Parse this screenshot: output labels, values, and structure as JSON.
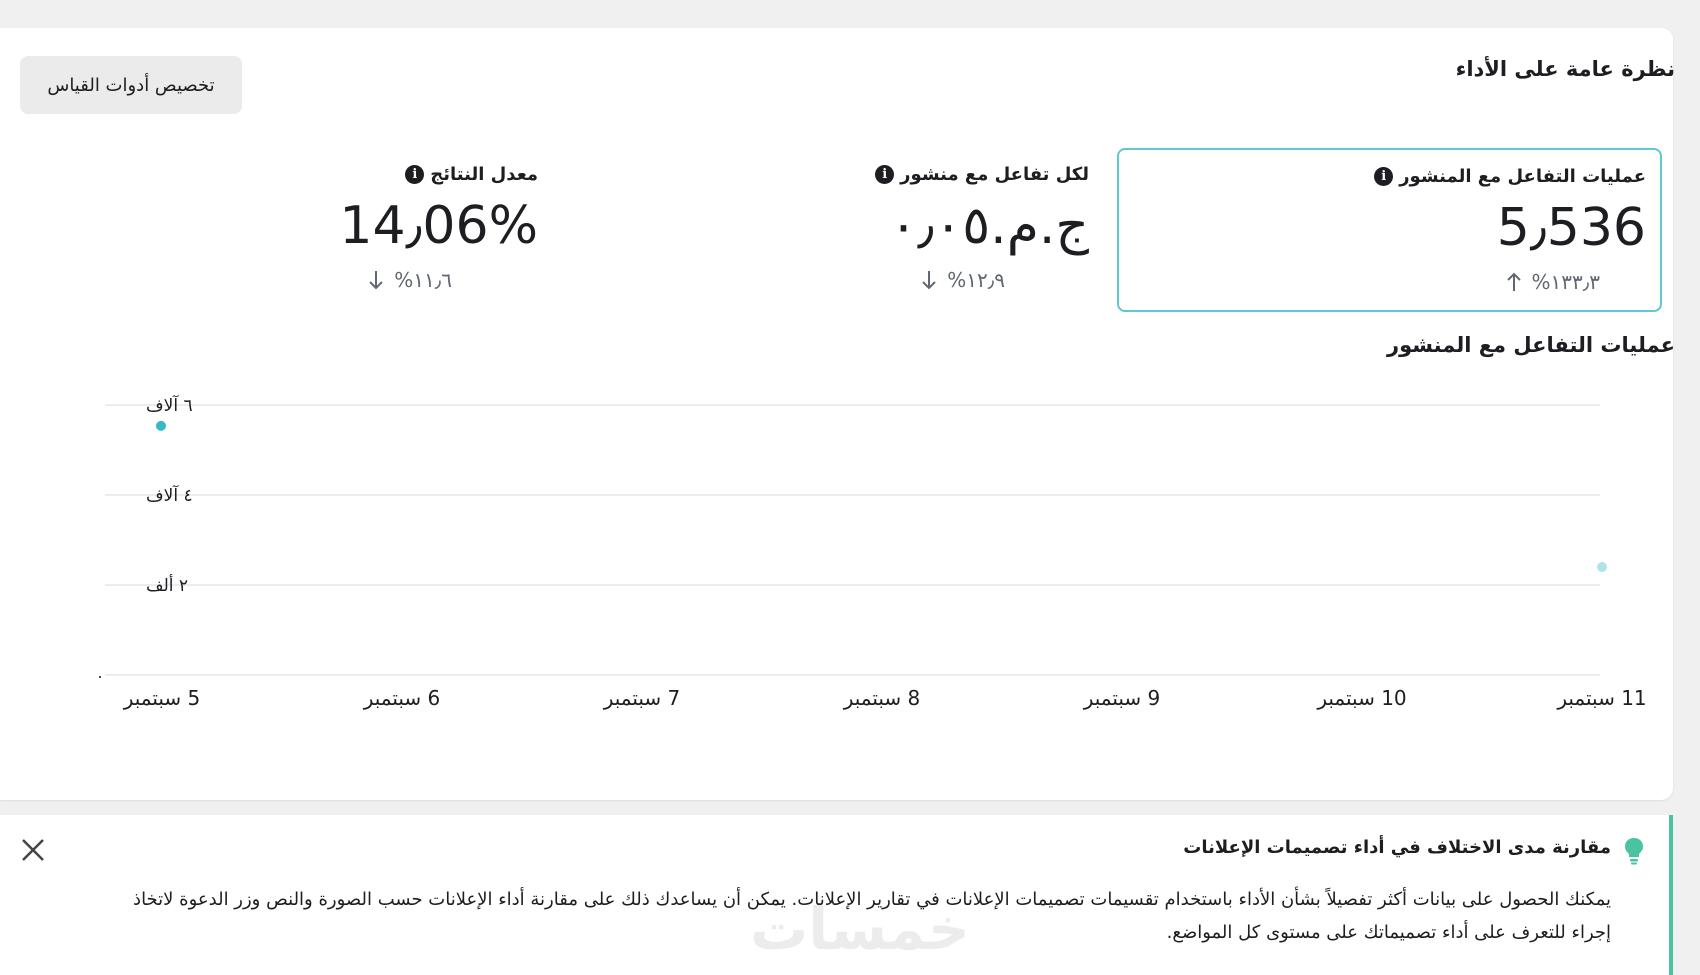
{
  "header": {
    "title": "نظرة عامة على الأداء",
    "customize_button": "تخصيص أدوات القياس"
  },
  "metrics": [
    {
      "label": "عمليات التفاعل مع المنشور",
      "value": "5٫536",
      "delta": "%١٣٣٫٣",
      "direction": "up",
      "selected": true
    },
    {
      "label": "لكل تفاعل مع منشور",
      "value": "ج.م.‏٠٫٠٥",
      "delta": "%١٢٫٩",
      "direction": "down",
      "selected": false
    },
    {
      "label": "معدل النتائج",
      "value": "14٫06%",
      "delta": "%١١٫٦",
      "direction": "down",
      "selected": false
    }
  ],
  "chart_title": "عمليات التفاعل مع المنشور",
  "chart_data": {
    "type": "scatter",
    "title": "عمليات التفاعل مع المنشور",
    "x": [
      "5 سبتمبر",
      "6 سبتمبر",
      "7 سبتمبر",
      "8 سبتمبر",
      "9 سبتمبر",
      "10 سبتمبر",
      "11 سبتمبر"
    ],
    "y_ticks": [
      "٢ ألف",
      "٤ آلاف",
      "٦ آلاف"
    ],
    "y_zero_label": ".",
    "ylim": [
      0,
      6000
    ],
    "series": [
      {
        "points": [
          {
            "x": "5 سبتمبر",
            "y": 5536
          },
          {
            "x": "11 سبتمبر",
            "y": 2400
          }
        ]
      }
    ],
    "grid": true,
    "colors": {
      "primary": "#34b9c7",
      "faded": "#aee3e8"
    }
  },
  "tip": {
    "title": "مقارنة مدى الاختلاف في أداء تصميمات الإعلانات",
    "body": "يمكنك الحصول على بيانات أكثر تفصيلاً بشأن الأداء باستخدام تقسيمات تصميمات الإعلانات في تقارير الإعلانات. يمكن أن يساعدك ذلك على مقارنة أداء الإعلانات حسب الصورة والنص وزر الدعوة لاتخاذ إجراء للتعرف على أداء تصميماتك على مستوى كل المواضع."
  },
  "watermark": "خمسات",
  "icons": {
    "info": "info-icon",
    "up": "arrow-up-icon",
    "down": "arrow-down-icon",
    "close": "close-icon",
    "bulb": "lightbulb-icon"
  },
  "colors": {
    "accent": "#5fc8d0",
    "tip_border": "#4cc3a0"
  }
}
